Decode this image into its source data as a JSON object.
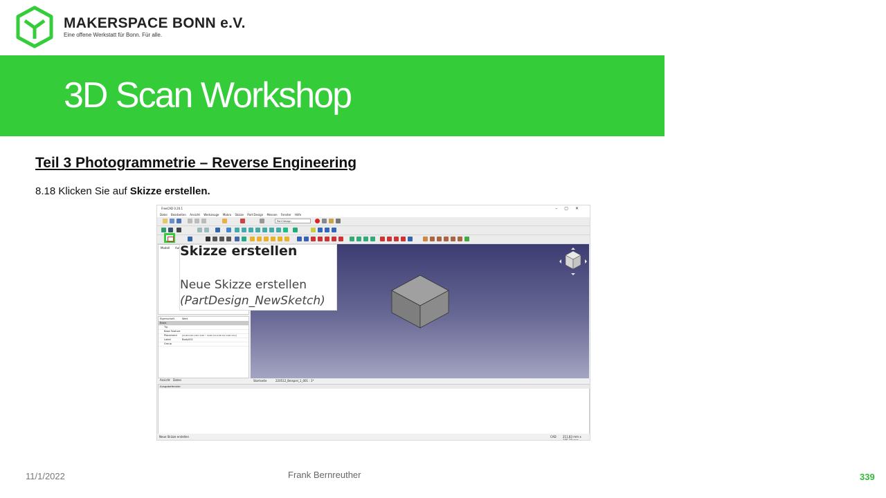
{
  "header": {
    "org_name": "MAKERSPACE BONN e.V.",
    "org_subtitle": "Eine offene Werkstatt für Bonn. Für alle.",
    "logo_icon": "hexagon-cube-logo",
    "accent_color": "#35cc3a"
  },
  "title": "3D Scan Workshop",
  "section_heading": "Teil 3  Photogrammetrie  – Reverse Engineering",
  "instruction": {
    "prefix": "8.18 Klicken Sie auf ",
    "bold": "Skizze erstellen."
  },
  "screenshot": {
    "window_title": "FreeCAD 0.20.1",
    "menu_items": [
      "Datei",
      "Bearbeiten",
      "Ansicht",
      "Werkzeuge",
      "Makro",
      "Skizze",
      "Part Design",
      "Messen",
      "Fenster",
      "Hilfe"
    ],
    "workbench_select": "Part Design",
    "tooltip": {
      "title": "Skizze erstellen",
      "description": "Neue Skizze erstellen",
      "command": "(PartDesign_NewSketch)"
    },
    "tree_headers": [
      "Modell",
      "Aufgaben"
    ],
    "property_header": [
      "Eigenschaft",
      "Wert"
    ],
    "property_group": "Basis",
    "properties": [
      {
        "name": "Tip",
        "value": ""
      },
      {
        "name": "Base Feature",
        "value": ""
      },
      {
        "name": "Placement",
        "value": "[(0,00 0,00 1,00); 0,00 °; (0,00 mm  0,00 mm  0,00 mm)]"
      },
      {
        "name": "Label",
        "value": "Body001"
      },
      {
        "name": "Group",
        "value": ""
      }
    ],
    "panel_tabs": [
      "Ansicht",
      "Daten"
    ],
    "doc_tabs": [
      "Startseite",
      "220512_Beispiel_1_001 : 1*"
    ],
    "report_title": "Ausgabefenster",
    "status_left": "Neue Skizze erstellen",
    "status_right": "CAD",
    "status_dims": "211,83 mm x 105,39 mm"
  },
  "footer": {
    "date": "11/1/2022",
    "author": "Frank Bernreuther",
    "page_number": "339"
  }
}
